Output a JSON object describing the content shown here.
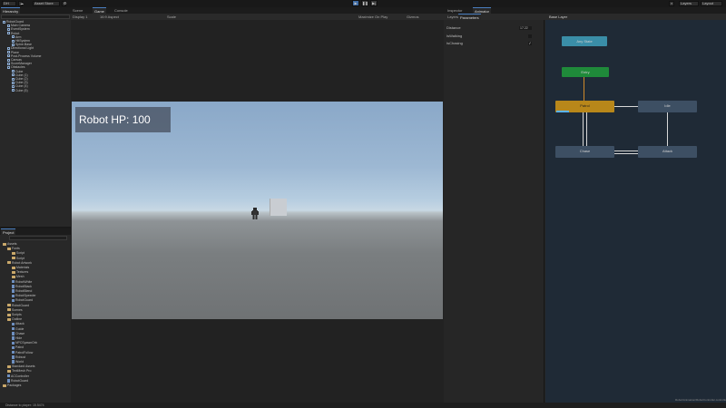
{
  "toolbar": {
    "account": "DH",
    "asset_store": "Asset Store",
    "layers": "Layers",
    "layout": "Layout",
    "play_icon": "play-icon",
    "pause_icon": "pause-icon",
    "step_icon": "step-icon"
  },
  "hierarchy": {
    "tab": "Hierarchy",
    "items": [
      {
        "label": "RobotGuard",
        "indent": 0
      },
      {
        "label": "Main Camera",
        "indent": 1
      },
      {
        "label": "EventSystem",
        "indent": 1
      },
      {
        "label": "Robot",
        "indent": 1
      },
      {
        "label": "Arm",
        "indent": 2
      },
      {
        "label": "HitSystem",
        "indent": 2
      },
      {
        "label": "Spine.Base",
        "indent": 2
      },
      {
        "label": "Directional Light",
        "indent": 1
      },
      {
        "label": "Plane",
        "indent": 1
      },
      {
        "label": "Post-Process Volume",
        "indent": 1
      },
      {
        "label": "Canvas",
        "indent": 1
      },
      {
        "label": "ScoreManager",
        "indent": 1
      },
      {
        "label": "Obstacles",
        "indent": 1
      },
      {
        "label": "Cube",
        "indent": 2
      },
      {
        "label": "Cube (1)",
        "indent": 2
      },
      {
        "label": "Cube (2)",
        "indent": 2
      },
      {
        "label": "Cube (3)",
        "indent": 2
      },
      {
        "label": "Cube (4)",
        "indent": 2
      },
      {
        "label": "Cube (5)",
        "indent": 2
      }
    ]
  },
  "scene_tabs": {
    "scene": "Scene",
    "game": "Game",
    "console": "Console"
  },
  "game_toolbar": {
    "display": "Display 1",
    "aspect": "16:9 Aspect",
    "scale": "Scale",
    "maximize": "Maximize On Play",
    "stats": "Stats",
    "gizmos": "Gizmos"
  },
  "game_view": {
    "hp_text": "Robot HP: 100"
  },
  "animator": {
    "tabs": [
      "Inspector",
      "Animator"
    ],
    "subtabs": [
      "Layers",
      "Parameters"
    ],
    "breadcrumb": "Base Layer",
    "params": [
      {
        "name": "Distance",
        "value": "17.22"
      },
      {
        "name": "IsWalking",
        "value": ""
      },
      {
        "name": "IsChasing",
        "value": "✓"
      }
    ],
    "states": {
      "any_state": "Any State",
      "entry": "Entry",
      "patrol": "Patrol",
      "idle": "Idle",
      "chase": "Chase",
      "attack": "Attack"
    },
    "footer": "Robot/Animation/RobotController.controller"
  },
  "project": {
    "tab": "Project",
    "items": [
      {
        "label": "Assets",
        "indent": 0,
        "type": "folder"
      },
      {
        "label": "Fonts",
        "indent": 1,
        "type": "folder"
      },
      {
        "label": "Script",
        "indent": 2,
        "type": "folder"
      },
      {
        "label": "Script",
        "indent": 2,
        "type": "folder"
      },
      {
        "label": "Robot Artwork",
        "indent": 1,
        "type": "folder"
      },
      {
        "label": "Materials",
        "indent": 2,
        "type": "folder"
      },
      {
        "label": "Textures",
        "indent": 2,
        "type": "folder"
      },
      {
        "label": "Mesh",
        "indent": 2,
        "type": "folder"
      },
      {
        "label": "RobotWhite",
        "indent": 2,
        "type": "file"
      },
      {
        "label": "RobotBlack",
        "indent": 2,
        "type": "file"
      },
      {
        "label": "RobotBlend",
        "indent": 2,
        "type": "file"
      },
      {
        "label": "RobotSpeeder",
        "indent": 2,
        "type": "file"
      },
      {
        "label": "RobotGuard",
        "indent": 2,
        "type": "file"
      },
      {
        "label": "RobotGuard",
        "indent": 1,
        "type": "folder"
      },
      {
        "label": "Scenes",
        "indent": 1,
        "type": "folder"
      },
      {
        "label": "Scripts",
        "indent": 1,
        "type": "folder"
      },
      {
        "label": "Outline",
        "indent": 1,
        "type": "folder"
      },
      {
        "label": "Attack",
        "indent": 2,
        "type": "file"
      },
      {
        "label": "Guide",
        "indent": 2,
        "type": "file"
      },
      {
        "label": "Chase",
        "indent": 2,
        "type": "file"
      },
      {
        "label": "Hide",
        "indent": 2,
        "type": "file"
      },
      {
        "label": "NPCSpawnOrb",
        "indent": 2,
        "type": "file"
      },
      {
        "label": "Patrol",
        "indent": 2,
        "type": "file"
      },
      {
        "label": "PatrolFollow",
        "indent": 2,
        "type": "file"
      },
      {
        "label": "Robust",
        "indent": 2,
        "type": "file"
      },
      {
        "label": "World",
        "indent": 2,
        "type": "file"
      },
      {
        "label": "Standard Assets",
        "indent": 1,
        "type": "folder"
      },
      {
        "label": "TextMesh Pro",
        "indent": 1,
        "type": "folder"
      },
      {
        "label": "ACController",
        "indent": 1,
        "type": "file"
      },
      {
        "label": "RobotGuard",
        "indent": 1,
        "type": "file"
      },
      {
        "label": "Packages",
        "indent": 0,
        "type": "folder"
      }
    ]
  },
  "statusbar": {
    "text": "Distance to player: 15.5474"
  }
}
